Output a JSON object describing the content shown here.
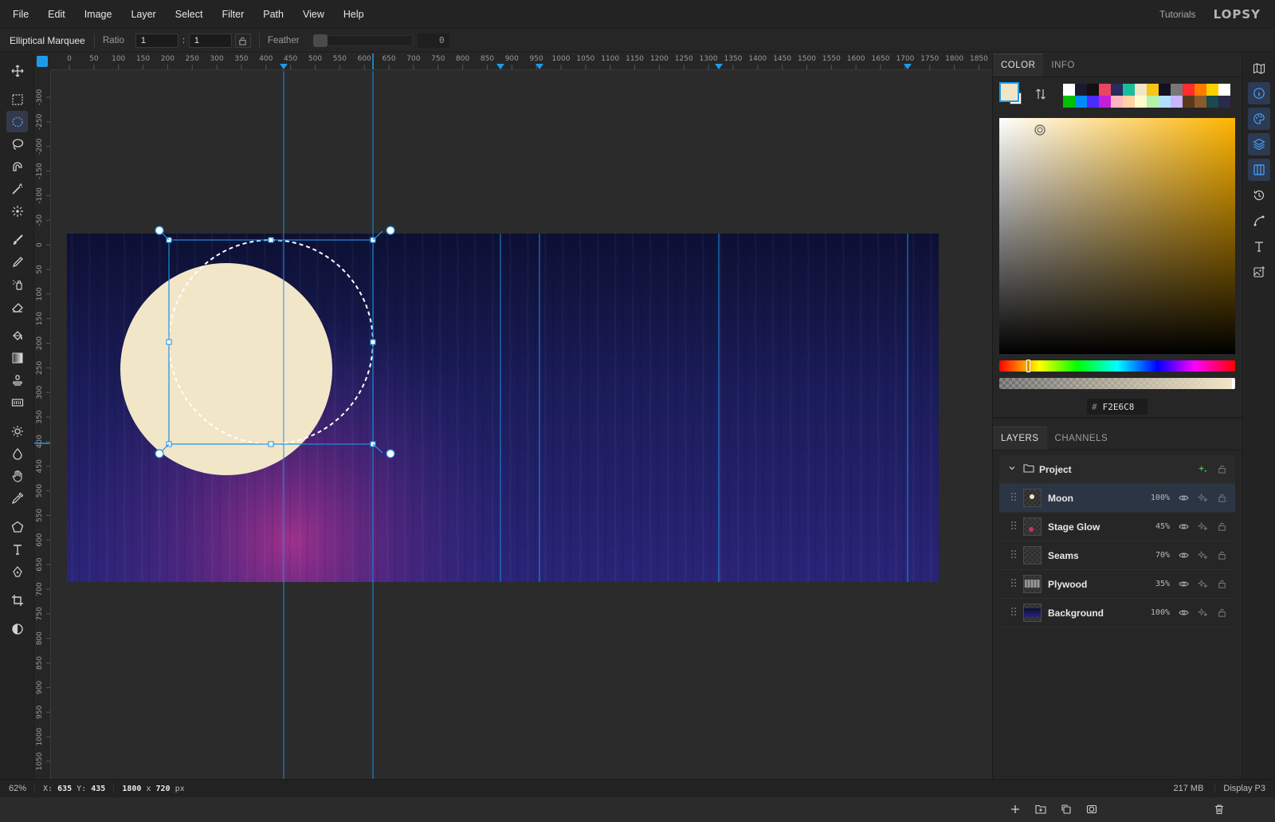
{
  "menu": [
    "File",
    "Edit",
    "Image",
    "Layer",
    "Select",
    "Filter",
    "Path",
    "View",
    "Help"
  ],
  "header": {
    "tutorials": "Tutorials",
    "logo": "LOPSY"
  },
  "options": {
    "tool_name": "Elliptical Marquee",
    "ratio_label": "Ratio",
    "ratio_w": "1",
    "ratio_sep": ":",
    "ratio_h": "1",
    "feather_label": "Feather",
    "feather_value": "0"
  },
  "rulers": {
    "h_ticks": [
      "0",
      "50",
      "100",
      "150",
      "200",
      "250",
      "300",
      "350",
      "400",
      "450",
      "500",
      "550",
      "600",
      "650",
      "700",
      "750",
      "800",
      "850",
      "900",
      "950",
      "1000",
      "1050",
      "1100",
      "1150",
      "1200",
      "1250",
      "1300",
      "1350",
      "1400",
      "1450",
      "1500",
      "1550",
      "1600",
      "1650",
      "1700",
      "1750",
      "1800",
      "1850"
    ],
    "v_ticks": [
      "-300",
      "-250",
      "-200",
      "-150",
      "-100",
      "-50",
      "0",
      "50",
      "100",
      "150",
      "200",
      "250",
      "300",
      "350",
      "400",
      "450",
      "500",
      "550",
      "600",
      "650",
      "700",
      "750",
      "800",
      "850",
      "900",
      "950",
      "1000",
      "1050"
    ]
  },
  "toolbar": [
    "move-tool",
    "rect-marquee-tool",
    "ellipse-marquee-tool",
    "lasso-tool",
    "magnetic-lasso-tool",
    "magic-wand-tool",
    "quick-select-tool",
    "brush-tool",
    "pencil-tool",
    "spray-tool",
    "eraser-tool",
    "bucket-tool",
    "gradient-tool",
    "stamp-tool",
    "pattern-tool",
    "dodge-tool",
    "blur-tool",
    "smudge-tool",
    "eyedropper-tool",
    "shape-tool",
    "text-tool",
    "pen-tool",
    "crop-tool",
    "contrast-tool"
  ],
  "color_panel": {
    "tabs": [
      "COLOR",
      "INFO"
    ],
    "hex_value": "F2E6C8",
    "hex_hash": "#",
    "foreground": "#f2e6c8",
    "swatches": [
      "#ffffff",
      "#1a1a2e",
      "#111111",
      "#e94560",
      "#2b2b5e",
      "#1abc9c",
      "#f2e6c8",
      "#f5c518",
      "#111122",
      "#777777",
      "#ff2d2d",
      "#ff7a00",
      "#ffd000",
      "#ffffff",
      "#00c000",
      "#008cff",
      "#4b2cff",
      "#c21fd8",
      "#ffb6c1",
      "#ffd1a3",
      "#fffacd",
      "#b4f0a8",
      "#b0e0ff",
      "#c8b4ff",
      "#5a3a1a",
      "#8b5a2b",
      "#1a4a4a",
      "#2a2a4a"
    ]
  },
  "layers_panel": {
    "tabs": [
      "LAYERS",
      "CHANNELS"
    ],
    "group": {
      "name": "Project"
    },
    "layers": [
      {
        "name": "Moon",
        "opacity": "100%",
        "selected": true
      },
      {
        "name": "Stage Glow",
        "opacity": "45%",
        "selected": false
      },
      {
        "name": "Seams",
        "opacity": "70%",
        "selected": false
      },
      {
        "name": "Plywood",
        "opacity": "35%",
        "selected": false
      },
      {
        "name": "Background",
        "opacity": "100%",
        "selected": false
      }
    ]
  },
  "status": {
    "zoom": "62%",
    "x_label": "X:",
    "x": "635",
    "y_label": "Y:",
    "y": "435",
    "doc_w": "1800",
    "doc_x": "x",
    "doc_h": "720",
    "doc_unit": "px",
    "memory": "217 MB",
    "profile": "Display P3"
  }
}
